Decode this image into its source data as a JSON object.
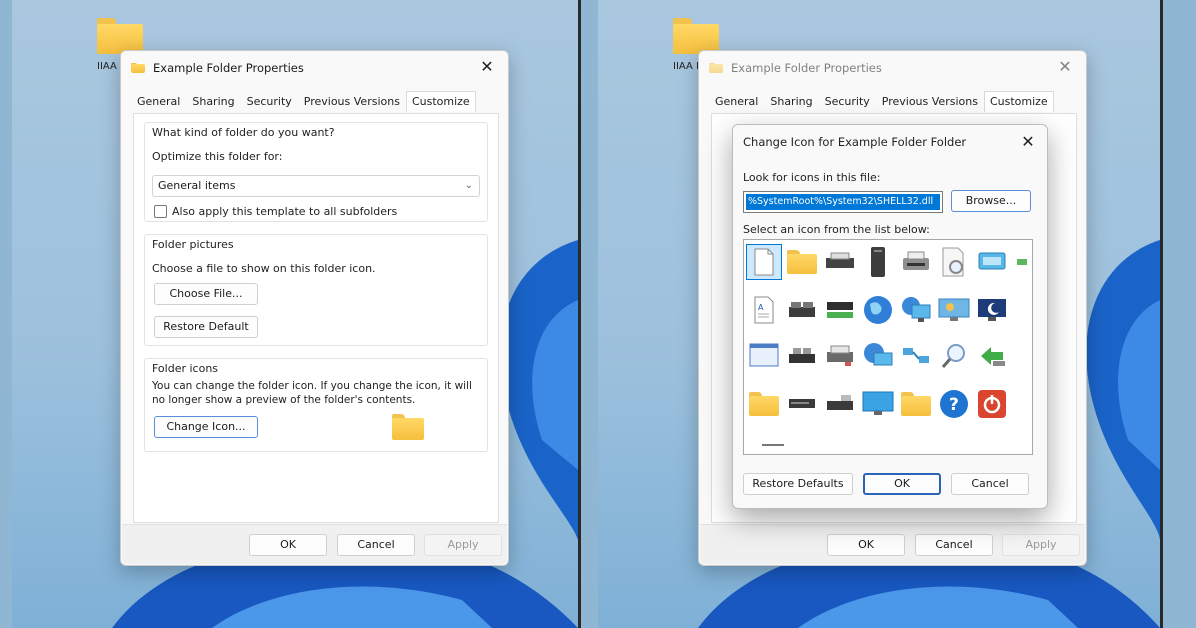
{
  "left": {
    "desktop_icon_label": "IIAA Ind",
    "window": {
      "title": "Example Folder Properties",
      "tabs": [
        "General",
        "Sharing",
        "Security",
        "Previous Versions",
        "Customize"
      ],
      "active_tab": "Customize",
      "kind_group": {
        "heading": "What kind of folder do you want?",
        "optimize_label": "Optimize this folder for:",
        "optimize_value": "General items",
        "subfolders_checkbox_label": "Also apply this template to all subfolders",
        "subfolders_checked": false
      },
      "pictures_group": {
        "heading": "Folder pictures",
        "description": "Choose a file to show on this folder icon.",
        "choose_button": "Choose File...",
        "restore_button": "Restore Default"
      },
      "icons_group": {
        "heading": "Folder icons",
        "description_line1": "You can change the folder icon. If you change the icon, it will",
        "description_line2": "no longer show a preview of the folder's contents.",
        "change_button": "Change Icon..."
      },
      "footer": {
        "ok": "OK",
        "cancel": "Cancel",
        "apply": "Apply"
      }
    }
  },
  "right": {
    "desktop_icon_label": "IIAA Ind",
    "window": {
      "title": "Example Folder Properties",
      "tabs": [
        "General",
        "Sharing",
        "Security",
        "Previous Versions",
        "Customize"
      ],
      "active_tab": "Customize",
      "footer": {
        "ok": "OK",
        "cancel": "Cancel",
        "apply": "Apply"
      }
    },
    "dialog": {
      "title": "Change Icon for Example Folder Folder",
      "look_label": "Look for icons in this file:",
      "file_path": "%SystemRoot%\\System32\\SHELL32.dll",
      "browse_button": "Browse...",
      "select_label": "Select an icon from the list below:",
      "icons": [
        [
          "document-icon",
          "folder-icon",
          "printer-icon",
          "server-tower-icon",
          "printer-icon",
          "document-search-icon",
          "monitor-icon"
        ],
        [
          "text-document-icon",
          "drive-icon",
          "network-drive-icon",
          "globe-icon",
          "network-monitor-icon",
          "desktop-icon",
          "sleep-monitor-icon"
        ],
        [
          "window-icon",
          "drive-icon",
          "printer-icon",
          "network-globe-icon",
          "network-icon",
          "search-icon",
          "green-arrow-icon"
        ],
        [
          "folder-icon",
          "drive-icon",
          "drive-icon",
          "monitor-icon",
          "folder-grid-icon",
          "help-icon",
          "power-icon"
        ]
      ],
      "restore_button": "Restore Defaults",
      "ok_button": "OK",
      "cancel_button": "Cancel"
    }
  },
  "colors": {
    "accent": "#0078d7",
    "folder_yellow": "#f5bf3d",
    "desktop_blue": "#1565c0"
  }
}
